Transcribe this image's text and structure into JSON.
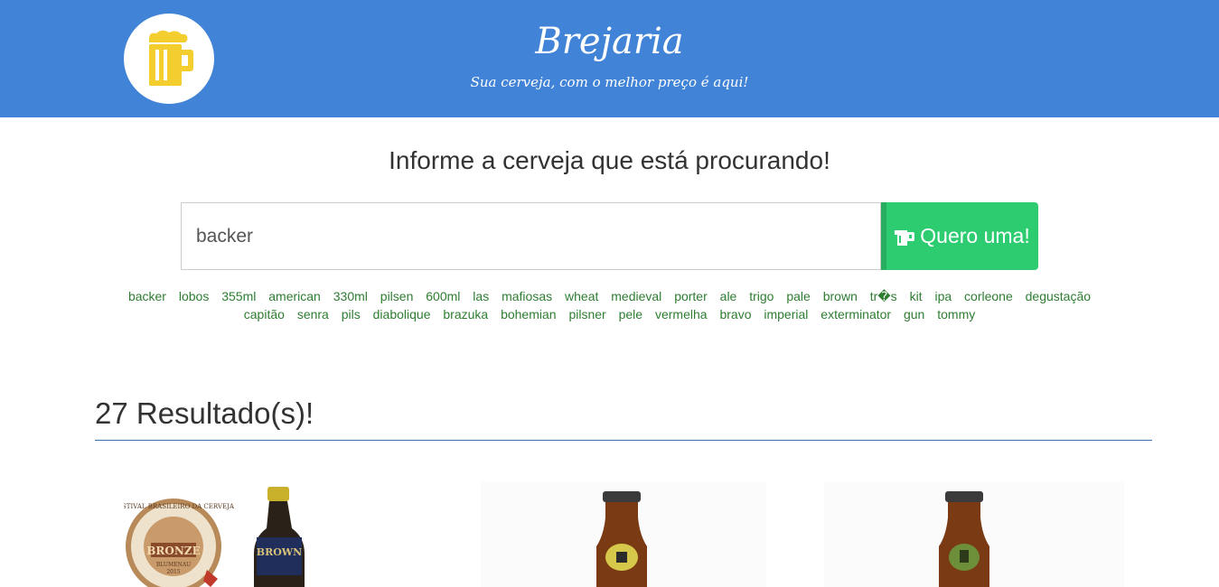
{
  "header": {
    "title": "Brejaria",
    "subtitle": "Sua cerveja, com o melhor preço é aqui!",
    "logo_icon": "beer-mug-icon",
    "bg_color": "#4183d7",
    "logo_color": "#f4cd2e"
  },
  "search": {
    "prompt": "Informe a cerveja que está procurando!",
    "value": "backer",
    "button_label": "Quero uma!",
    "button_icon": "beer-glass-icon",
    "button_color": "#2ecc71"
  },
  "tags": [
    "backer",
    "lobos",
    "355ml",
    "american",
    "330ml",
    "pilsen",
    "600ml",
    "las",
    "mafiosas",
    "wheat",
    "medieval",
    "porter",
    "ale",
    "trigo",
    "pale",
    "brown",
    "tr�s",
    "kit",
    "ipa",
    "corleone",
    "degustação",
    "capitão",
    "senra",
    "pils",
    "diabolique",
    "brazuka",
    "bohemian",
    "pilsner",
    "pele",
    "vermelha",
    "bravo",
    "imperial",
    "exterminator",
    "gun",
    "tommy"
  ],
  "results": {
    "title": "27 Resultado(s)!",
    "cards": [
      {
        "medal_text": "FESTIVAL BRASILEIRO DA CERVEJA",
        "medal_award": "BRONZE",
        "medal_place": "BLUMENAU",
        "medal_year": "2015",
        "bottle_label": "BROWN"
      },
      {},
      {}
    ]
  }
}
